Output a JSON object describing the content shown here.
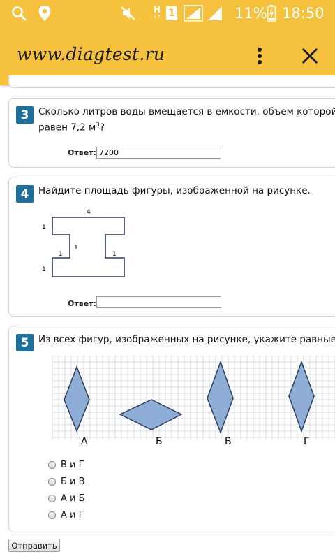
{
  "status_bar": {
    "icons": [
      "search-icon",
      "location-icon",
      "mute-icon",
      "network-h-icon",
      "sim-1-icon",
      "signal-icon",
      "signal-icon",
      "battery-charging-icon"
    ],
    "network_type": "H",
    "sim_number": "1",
    "battery": "11%",
    "time": "18:50"
  },
  "app_bar": {
    "url": "www.diagtest.ru",
    "menu_icon": "more-vert-icon",
    "close_icon": "close-icon"
  },
  "q3": {
    "number": "3",
    "text_line1": "Сколько литров воды вмещается в емкости, объем которой",
    "text_line2_a": "равен  7,2 м",
    "text_line2_sup": "3",
    "text_line2_b": "?",
    "answer_label": "Ответ:",
    "answer_value": "7200"
  },
  "q4": {
    "number": "4",
    "text": "Найдите площадь фигуры, изображенной на рисунке.",
    "figure_labels": {
      "top": "4",
      "left_top": "1",
      "left_bottom": "1",
      "inner_left": "1",
      "inner_mid": "1",
      "inner_right": "1"
    },
    "answer_label": "Ответ:",
    "answer_value": ""
  },
  "q5": {
    "number": "5",
    "text": "Из всех фигур, изображенных на рисунке, укажите равные.",
    "figure_labels": [
      "А",
      "Б",
      "В",
      "Г"
    ],
    "shape_fill": "#8eaed8",
    "options": [
      "В и Г",
      "Б и В",
      "А и Б",
      "А и Г"
    ]
  },
  "submit_label": "Отправить"
}
